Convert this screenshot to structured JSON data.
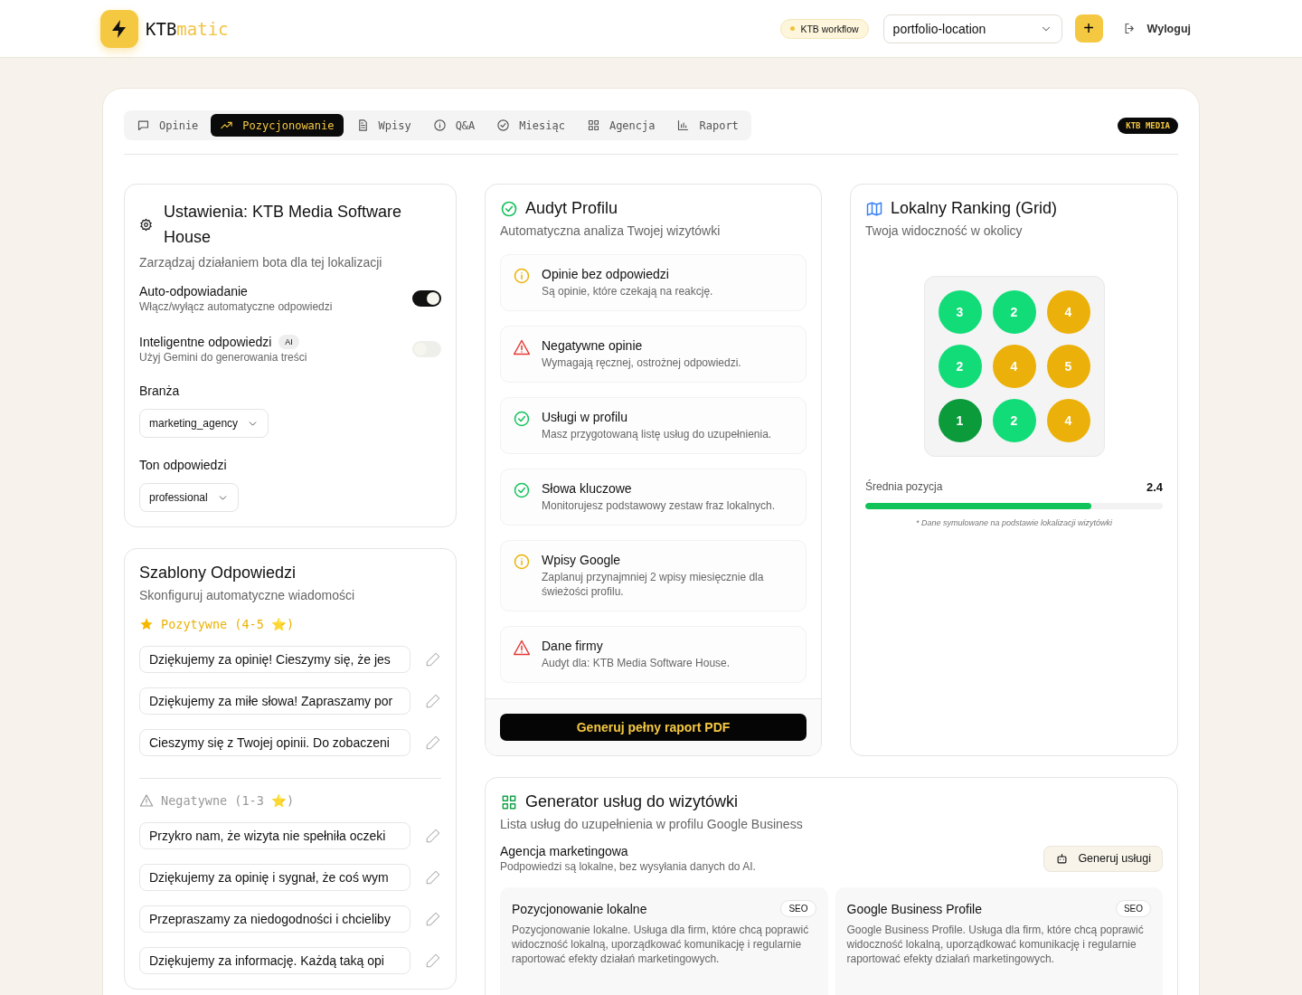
{
  "header": {
    "brand_dark": "KTB",
    "brand_accent": "matic",
    "badge": "KTB workflow",
    "location_select": "portfolio-location",
    "add_button": "+",
    "logout": "Wyloguj"
  },
  "tabs": [
    {
      "label": "Opinie",
      "kind": "chat",
      "selected": false
    },
    {
      "label": "Pozycjonowanie",
      "kind": "trend",
      "selected": true
    },
    {
      "label": "Wpisy",
      "kind": "doc",
      "selected": false
    },
    {
      "label": "Q&A",
      "kind": "info",
      "selected": false
    },
    {
      "label": "Miesiąc",
      "kind": "check",
      "selected": false
    },
    {
      "label": "Agencja",
      "kind": "grid",
      "selected": false
    },
    {
      "label": "Raport",
      "kind": "chart",
      "selected": false
    }
  ],
  "brand_badge": "KTB MEDIA",
  "settings": {
    "title": "Ustawienia: KTB Media Software House",
    "subtitle": "Zarządzaj działaniem bota dla tej lokalizacji",
    "toggles": [
      {
        "label": "Auto-odpowiadanie",
        "description": "Włącz/wyłącz automatyczne odpowiedzi",
        "on": true
      },
      {
        "label": "Inteligentne odpowiedzi",
        "badge": "AI",
        "description": "Użyj Gemini do generowania treści",
        "on": false
      }
    ],
    "selects": [
      {
        "label": "Branża",
        "value": "marketing_agency"
      },
      {
        "label": "Ton odpowiedzi",
        "value": "professional"
      }
    ]
  },
  "templates": {
    "title": "Szablony Odpowiedzi",
    "subtitle": "Skonfiguruj automatyczne wiadomości",
    "groups": [
      {
        "kind": "positive",
        "label": "Pozytywne (4-5 ⭐)",
        "items": [
          "Dziękujemy za opinię! Cieszymy się, że jes",
          "Dziękujemy za miłe słowa! Zapraszamy por",
          "Cieszymy się z Twojej opinii. Do zobaczeni"
        ]
      },
      {
        "kind": "negative",
        "label": "Negatywne (1-3 ⭐)",
        "items": [
          "Przykro nam, że wizyta nie spełniła oczeki",
          "Dziękujemy za opinię i sygnał, że coś wym",
          "Przepraszamy za niedogodności i chcieliby",
          "Dziękujemy za informację. Każdą taką opi"
        ]
      }
    ]
  },
  "audit": {
    "title": "Audyt Profilu",
    "subtitle": "Automatyczna analiza Twojej wizytówki",
    "items": [
      {
        "kind": "info",
        "title": "Opinie bez odpowiedzi",
        "text": "Są opinie, które czekają na reakcję."
      },
      {
        "kind": "warning",
        "title": "Negatywne opinie",
        "text": "Wymagają ręcznej, ostrożnej odpowiedzi."
      },
      {
        "kind": "ok",
        "title": "Usługi w profilu",
        "text": "Masz przygotowaną listę usług do uzupełnienia."
      },
      {
        "kind": "ok",
        "title": "Słowa kluczowe",
        "text": "Monitorujesz podstawowy zestaw fraz lokalnych."
      },
      {
        "kind": "info",
        "title": "Wpisy Google",
        "text": "Zaplanuj przynajmniej 2 wpisy miesięcznie dla świeżości profilu."
      },
      {
        "kind": "warning",
        "title": "Dane firmy",
        "text": "Audyt dla: KTB Media Software House."
      }
    ],
    "button": "Generuj pełny raport PDF"
  },
  "ranking": {
    "title": "Lokalny Ranking (Grid)",
    "subtitle": "Twoja widoczność w okolicy",
    "cells": [
      {
        "value": "3",
        "color": "#12dc78"
      },
      {
        "value": "2",
        "color": "#12dc78"
      },
      {
        "value": "4",
        "color": "#ebb10a"
      },
      {
        "value": "2",
        "color": "#12dc78"
      },
      {
        "value": "4",
        "color": "#ebb10a"
      },
      {
        "value": "5",
        "color": "#ebb10a"
      },
      {
        "value": "1",
        "color": "#0b9b3b"
      },
      {
        "value": "2",
        "color": "#12dc78"
      },
      {
        "value": "4",
        "color": "#ebb10a"
      }
    ],
    "average_label": "Średnia pozycja",
    "average_value": "2.4",
    "level": 0.76,
    "note": "* Dane symulowane na podstawie lokalizacji wizytówki"
  },
  "generator": {
    "title": "Generator usług do wizytówki",
    "subtitle": "Lista usług do uzupełnienia w profilu Google Business",
    "category": "Agencja marketingowa",
    "category_note": "Podpowiedzi są lokalne, bez wysyłania danych do AI.",
    "button": "Generuj usługi",
    "services": [
      {
        "title": "Pozycjonowanie lokalne",
        "tag": "SEO",
        "text": "Pozycjonowanie lokalne. Usługa dla firm, które chcą poprawić widoczność lokalną, uporządkować komunikację i regularnie raportować efekty działań marketingowych."
      },
      {
        "title": "Google Business Profile",
        "tag": "SEO",
        "text": "Google Business Profile. Usługa dla firm, które chcą poprawić widoczność lokalną, uporządkować komunikację i regularnie raportować efekty działań marketingowych."
      }
    ]
  }
}
